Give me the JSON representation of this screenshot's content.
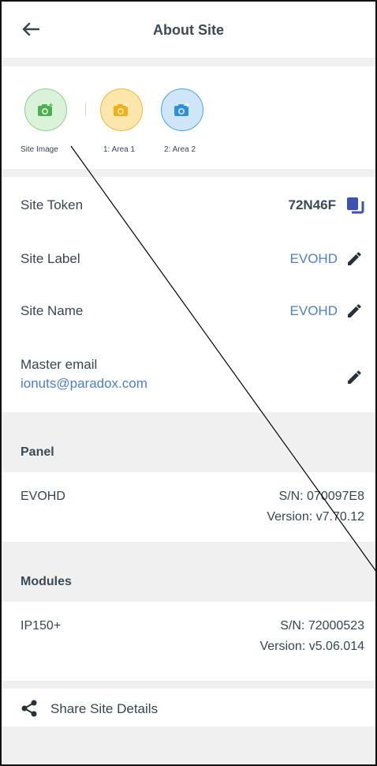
{
  "header": {
    "title": "About Site",
    "back_icon": "arrow-left-icon"
  },
  "images": [
    {
      "caption": "Site Image",
      "color": "#8fd18f",
      "bg": "#d9f2d9",
      "icon": "camera-add-icon"
    },
    {
      "caption": "1: Area 1",
      "color": "#f2b83c",
      "bg": "#fde6ab",
      "icon": "camera-add-icon"
    },
    {
      "caption": "2: Area 2",
      "color": "#4da3e6",
      "bg": "#cfe6f8",
      "icon": "camera-add-icon"
    }
  ],
  "site_token": {
    "label": "Site Token",
    "value": "72N46F",
    "icon": "copy-icon"
  },
  "site_label": {
    "label": "Site Label",
    "value": "EVOHD",
    "icon": "pencil-icon"
  },
  "site_name": {
    "label": "Site Name",
    "value": "EVOHD",
    "icon": "pencil-icon"
  },
  "master_email": {
    "label": "Master email",
    "value": "ionuts@paradox.com",
    "icon": "pencil-icon"
  },
  "panel": {
    "title": "Panel",
    "name": "EVOHD",
    "serial": "S/N: 070097E8",
    "version": "Version: v7.70.12"
  },
  "modules": {
    "title": "Modules",
    "name": "IP150+",
    "serial": "S/N: 72000523",
    "version": "Version: v5.06.014"
  },
  "share": {
    "label": "Share Site Details",
    "icon": "share-icon"
  },
  "colors": {
    "accent": "#4a7fd6",
    "text": "#37474f",
    "gap": "#f0f0f0"
  }
}
